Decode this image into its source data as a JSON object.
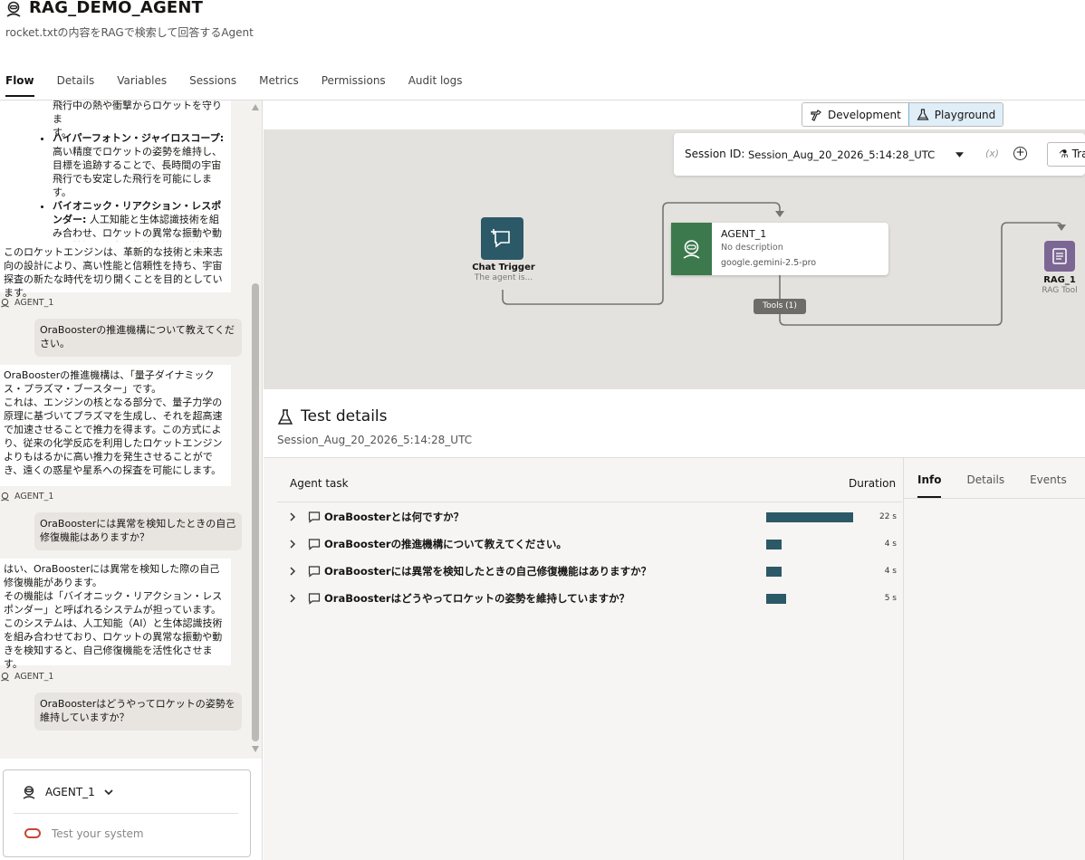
{
  "header": {
    "title": "RAG_DEMO_AGENT",
    "subtitle": "rocket.txtの内容をRAGで検索して回答するAgent"
  },
  "tabs": [
    "Flow",
    "Details",
    "Variables",
    "Sessions",
    "Metrics",
    "Permissions",
    "Audit logs"
  ],
  "chat": {
    "partial_top_lines": [
      "飛行中の熱や衝撃からロケットを守りま",
      "す。"
    ],
    "bullets": [
      {
        "title": "ハイパーフォトン・ジャイロスコープ:",
        "text": " 高い精度でロケットの姿勢を維持し、目標を追跡することで、長時間の宇宙飛行でも安定した飛行を可能にします。"
      },
      {
        "title": "バイオニック・リアクション・レスポンダー:",
        "text": " 人工知能と生体認識技術を組み合わせ、ロケットの異常な振動や動きを検知して自己修復機能を活性化させます。"
      }
    ],
    "summary": "このロケットエンジンは、革新的な技術と未来志向の設計により、高い性能と信頼性を持ち、宇宙探査の新たな時代を切り開くことを目的としています。",
    "agent_label": "AGENT_1",
    "q1": "OraBoosterの推進機構について教えてください。",
    "a1": "OraBoosterの推進機構は、「量子ダイナミックス・プラズマ・ブースター」です。\nこれは、エンジンの核となる部分で、量子力学の原理に基づいてプラズマを生成し、それを超高速で加速させることで推力を得ます。この方式により、従来の化学反応を利用したロケットエンジンよりもはるかに高い推力を発生させることができ、遠くの惑星や星系への探査を可能にします。",
    "q2": "OraBoosterには異常を検知したときの自己修復機能はありますか？",
    "a2": "はい、OraBoosterには異常を検知した際の自己修復機能があります。\nその機能は「バイオニック・リアクション・レスポンダー」と呼ばれるシステムが担っています。このシステムは、人工知能（AI）と生体認識技術を組み合わせており、ロケットの異常な振動や動きを検知すると、自己修復機能を活性化させます。",
    "q3": "OraBoosterはどうやってロケットの姿勢を維持していますか？"
  },
  "input": {
    "agent": "AGENT_1",
    "placeholder": "Test your system"
  },
  "mode": {
    "development": "Development",
    "playground": "Playground"
  },
  "session": {
    "label": "Session ID:",
    "value": "Session_Aug_20_2026_5:14:28_UTC",
    "trace_partial": "Tra"
  },
  "nodes": {
    "chat_trigger": {
      "name": "Chat Trigger",
      "desc": "The agent is..."
    },
    "agent": {
      "name": "AGENT_1",
      "desc": "No description",
      "model": "google.gemini-2.5-pro"
    },
    "tools_badge": "Tools (1)",
    "rag": {
      "name": "RAG_1",
      "desc": "RAG Tool"
    }
  },
  "test_details": {
    "title": "Test details",
    "session": "Session_Aug_20_2026_5:14:28_UTC",
    "col_task": "Agent task",
    "col_duration": "Duration",
    "tasks": [
      {
        "label": "OraBoosterとは何ですか？",
        "duration": "22 s",
        "seconds": 22
      },
      {
        "label": "OraBoosterの推進機構について教えてください。",
        "duration": "4 s",
        "seconds": 4
      },
      {
        "label": "OraBoosterには異常を検知したときの自己修復機能はありますか？",
        "duration": "4 s",
        "seconds": 4
      },
      {
        "label": "OraBoosterはどうやってロケットの姿勢を維持していますか？",
        "duration": "5 s",
        "seconds": 5
      }
    ],
    "info_tabs": [
      "Info",
      "Details",
      "Events"
    ]
  },
  "colors": {
    "trigger": "#2c5967",
    "agent": "#3c7a4d",
    "rag": "#7c6693",
    "bar": "#2c5967",
    "input_accent": "#c74634"
  }
}
